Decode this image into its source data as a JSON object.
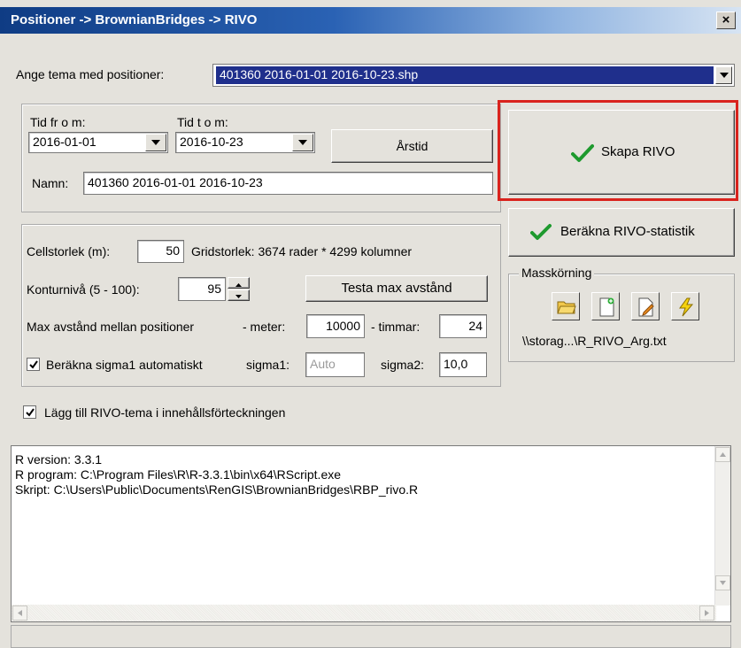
{
  "window": {
    "title": "Positioner -> BrownianBridges -> RIVO",
    "close_glyph": "×"
  },
  "theme": {
    "label": "Ange tema med positioner:",
    "selected": "401360 2016-01-01 2016-10-23.shp",
    "selected_bg": "#1f2f8c"
  },
  "time": {
    "from_label": "Tid fr o m:",
    "from_value": "2016-01-01",
    "to_label": "Tid t o m:",
    "to_value": "2016-10-23",
    "season_button": "Årstid",
    "name_label": "Namn:",
    "name_value": "401360 2016-01-01 2016-10-23"
  },
  "grid": {
    "cell_label": "Cellstorlek (m):",
    "cell_value": "50",
    "grid_text": "Gridstorlek: 3674 rader * 4299 kolumner",
    "contour_label": "Konturnivå (5 - 100):",
    "contour_value": "95",
    "test_button": "Testa max avstånd",
    "maxdist_label": "Max avstånd mellan positioner",
    "meter_label": "- meter:",
    "meter_value": "10000",
    "hours_label": "- timmar:",
    "hours_value": "24",
    "sigma_auto_label": "Beräkna sigma1 automatiskt",
    "sigma_auto_checked": true,
    "sigma1_label": "sigma1:",
    "sigma1_placeholder": "Auto",
    "sigma2_label": "sigma2:",
    "sigma2_value": "10,0"
  },
  "add_to_toc": {
    "label": "Lägg till RIVO-tema i innehållsförteckningen",
    "checked": true
  },
  "actions": {
    "create_button": "Skapa RIVO",
    "stats_button": "Beräkna RIVO-statistik",
    "highlight_color": "#d9231d"
  },
  "batch": {
    "label": "Masskörning",
    "file": "\\\\storag...\\R_RIVO_Arg.txt",
    "icons": [
      "open-folder-icon",
      "new-file-icon",
      "edit-file-icon",
      "lightning-icon"
    ]
  },
  "output": {
    "lines": [
      "R version: 3.3.1",
      "R program: C:\\Program Files\\R\\R-3.3.1\\bin\\x64\\RScript.exe",
      "Skript: C:\\Users\\Public\\Documents\\RenGIS\\BrownianBridges\\RBP_rivo.R"
    ]
  }
}
